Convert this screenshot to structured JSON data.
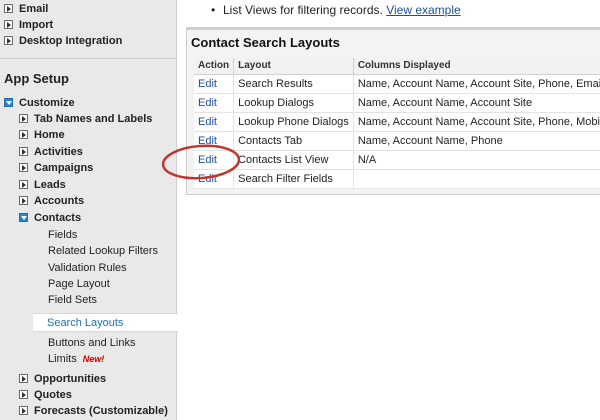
{
  "sidebar": {
    "top_items": [
      {
        "label": "Email"
      },
      {
        "label": "Import"
      },
      {
        "label": "Desktop Integration"
      }
    ],
    "section_title": "App Setup",
    "customize_label": "Customize",
    "items": [
      {
        "label": "Tab Names and Labels"
      },
      {
        "label": "Home"
      },
      {
        "label": "Activities"
      },
      {
        "label": "Campaigns"
      },
      {
        "label": "Leads"
      },
      {
        "label": "Accounts"
      }
    ],
    "contacts_label": "Contacts",
    "contacts_children": [
      {
        "label": "Fields"
      },
      {
        "label": "Related Lookup Filters"
      },
      {
        "label": "Validation Rules"
      },
      {
        "label": "Page Layout"
      },
      {
        "label": "Field Sets"
      }
    ],
    "selected_item": "Search Layouts",
    "contacts_children_after": [
      {
        "label": "Buttons and Links"
      },
      {
        "label": "Limits",
        "badge": "New!"
      }
    ],
    "bottom_items": [
      {
        "label": "Opportunities"
      },
      {
        "label": "Quotes"
      },
      {
        "label": "Forecasts (Customizable)"
      }
    ]
  },
  "main": {
    "bullet_text": "List Views for filtering records.",
    "bullet_link": "View example",
    "panel_title": "Contact Search Layouts",
    "table": {
      "headers": [
        "Action",
        "Layout",
        "Columns Displayed"
      ],
      "rows": [
        {
          "action": "Edit",
          "layout": "Search Results",
          "columns": "Name, Account Name, Account Site, Phone, Email, Co"
        },
        {
          "action": "Edit",
          "layout": "Lookup Dialogs",
          "columns": "Name, Account Name, Account Site"
        },
        {
          "action": "Edit",
          "layout": "Lookup Phone Dialogs",
          "columns": "Name, Account Name, Account Site, Phone, Mobile, H"
        },
        {
          "action": "Edit",
          "layout": "Contacts Tab",
          "columns": "Name, Account Name, Phone"
        },
        {
          "action": "Edit",
          "layout": "Contacts List View",
          "columns": "N/A"
        },
        {
          "action": "Edit",
          "layout": "Search Filter Fields",
          "columns": ""
        }
      ]
    }
  },
  "colors": {
    "link": "#1f4fa0",
    "annotation": "#c0362c",
    "sidebar_bg": "#e9e9e9",
    "new_badge": "#d40000"
  }
}
